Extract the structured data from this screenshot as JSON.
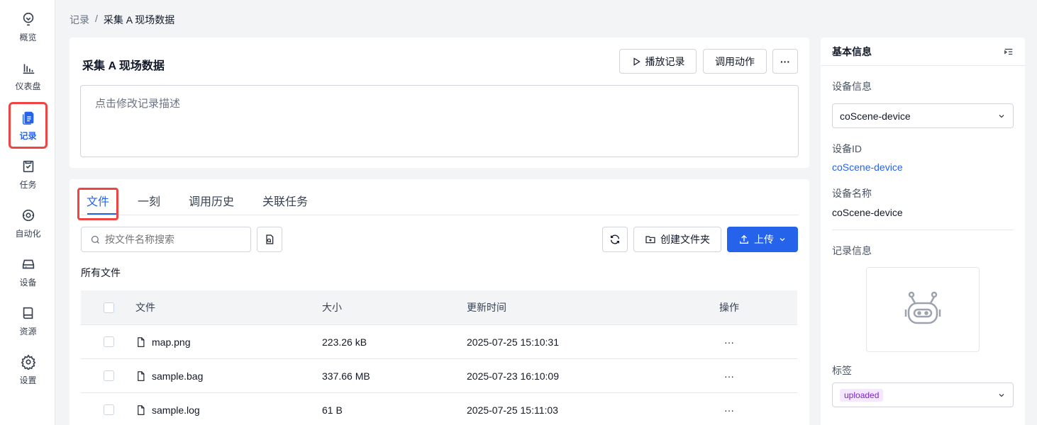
{
  "nav": [
    {
      "label": "概览",
      "icon": "lightbulb-icon"
    },
    {
      "label": "仪表盘",
      "icon": "bar-chart-icon"
    },
    {
      "label": "记录",
      "icon": "records-icon"
    },
    {
      "label": "任务",
      "icon": "task-icon"
    },
    {
      "label": "自动化",
      "icon": "automation-icon"
    },
    {
      "label": "设备",
      "icon": "device-icon"
    },
    {
      "label": "资源",
      "icon": "book-icon"
    },
    {
      "label": "设置",
      "icon": "gear-icon"
    }
  ],
  "breadcrumb": {
    "parent": "记录",
    "sep": "/",
    "current": "采集 A 现场数据"
  },
  "record": {
    "title": "采集 A 现场数据",
    "play_label": "播放记录",
    "invoke_label": "调用动作",
    "more_label": "···",
    "description_placeholder": "点击修改记录描述"
  },
  "tabs": [
    "文件",
    "一刻",
    "调用历史",
    "关联任务"
  ],
  "files": {
    "search_placeholder": "按文件名称搜索",
    "create_folder_label": "创建文件夹",
    "upload_label": "上传",
    "section_label": "所有文件",
    "columns": {
      "name": "文件",
      "size": "大小",
      "time": "更新时间",
      "op": "操作"
    },
    "rows": [
      {
        "name": "map.png",
        "size": "223.26 kB",
        "time": "2025-07-25 15:10:31",
        "op": "···"
      },
      {
        "name": "sample.bag",
        "size": "337.66 MB",
        "time": "2025-07-23 16:10:09",
        "op": "···"
      },
      {
        "name": "sample.log",
        "size": "61 B",
        "time": "2025-07-25 15:11:03",
        "op": "···"
      }
    ]
  },
  "side": {
    "title": "基本信息",
    "device_info_label": "设备信息",
    "device_select": "coScene-device",
    "device_id_label": "设备ID",
    "device_id": "coScene-device",
    "device_name_label": "设备名称",
    "device_name": "coScene-device",
    "record_info_label": "记录信息",
    "tags_label": "标签",
    "tag": "uploaded"
  },
  "colors": {
    "accent": "#2563eb",
    "highlight": "#ef4444",
    "tag_bg": "#f3e8ff",
    "tag_fg": "#7e22ce"
  }
}
